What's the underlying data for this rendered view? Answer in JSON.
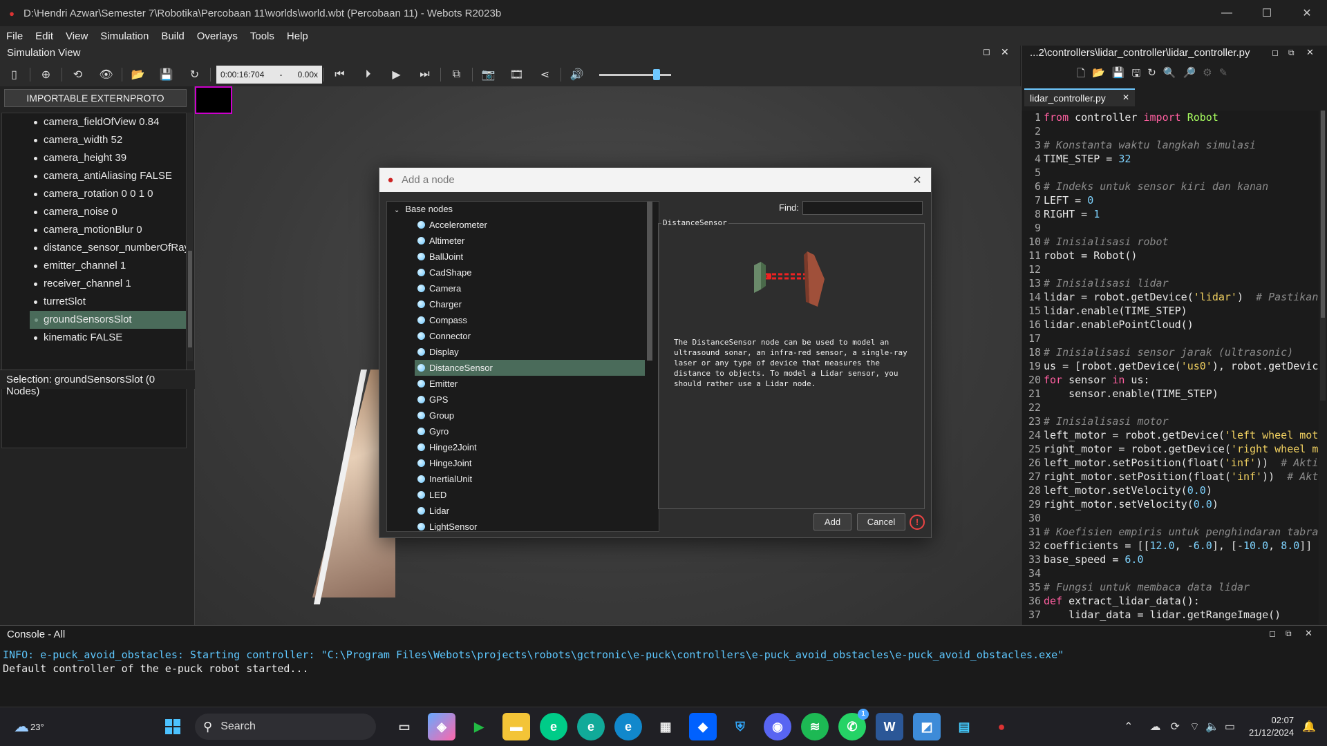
{
  "window": {
    "title": "D:\\Hendri Azwar\\Semester 7\\Robotika\\Percobaan 11\\worlds\\world.wbt (Percobaan 11) - Webots R2023b"
  },
  "menu": [
    "File",
    "Edit",
    "View",
    "Simulation",
    "Build",
    "Overlays",
    "Tools",
    "Help"
  ],
  "sim_view": {
    "title": "Simulation View",
    "time": "0:00:16:704",
    "sep": "-",
    "speed": "0.00x"
  },
  "scene": {
    "proto_button": "IMPORTABLE EXTERNPROTO",
    "fields": [
      "camera_fieldOfView 0.84",
      "camera_width 52",
      "camera_height 39",
      "camera_antiAliasing FALSE",
      "camera_rotation 0 0 1 0",
      "camera_noise 0",
      "camera_motionBlur 0",
      "distance_sensor_numberOfRays",
      "emitter_channel 1",
      "receiver_channel 1",
      "turretSlot",
      "groundSensorsSlot",
      "kinematic FALSE"
    ],
    "selection": "Selection: groundSensorsSlot (0 Nodes)"
  },
  "editor": {
    "path": "...2\\controllers\\lidar_controller\\lidar_controller.py",
    "tab": "lidar_controller.py",
    "lines": [
      "from controller import Robot",
      "",
      "# Konstanta waktu langkah simulasi",
      "TIME_STEP = 32",
      "",
      "# Indeks untuk sensor kiri dan kanan",
      "LEFT = 0",
      "RIGHT = 1",
      "",
      "# Inisialisasi robot",
      "robot = Robot()",
      "",
      "# Inisialisasi lidar",
      "lidar = robot.getDevice('lidar')  # Pastikan",
      "lidar.enable(TIME_STEP)",
      "lidar.enablePointCloud()",
      "",
      "# Inisialisasi sensor jarak (ultrasonic)",
      "us = [robot.getDevice('us0'), robot.getDevic",
      "for sensor in us:",
      "    sensor.enable(TIME_STEP)",
      "",
      "# Inisialisasi motor",
      "left_motor = robot.getDevice('left wheel mot",
      "right_motor = robot.getDevice('right wheel m",
      "left_motor.setPosition(float('inf'))  # Akti",
      "right_motor.setPosition(float('inf'))  # Akt",
      "left_motor.setVelocity(0.0)",
      "right_motor.setVelocity(0.0)",
      "",
      "# Koefisien empiris untuk penghindaran tabra",
      "coefficients = [[12.0, -6.0], [-10.0, 8.0]]",
      "base_speed = 6.0",
      "",
      "# Fungsi untuk membaca data lidar",
      "def extract_lidar_data():",
      "    lidar_data = lidar.getRangeImage()"
    ]
  },
  "dialog": {
    "title": "Add a node",
    "group": "Base nodes",
    "find_label": "Find:",
    "preview_title": "DistanceSensor",
    "description": "The DistanceSensor node can be used to model an ultrasound sonar, an infra-red sensor, a single-ray laser or any type of device that measures the distance to objects. To model a Lidar sensor, you should rather use a Lidar node.",
    "nodes": [
      "Accelerometer",
      "Altimeter",
      "BallJoint",
      "CadShape",
      "Camera",
      "Charger",
      "Compass",
      "Connector",
      "Display",
      "DistanceSensor",
      "Emitter",
      "GPS",
      "Group",
      "Gyro",
      "Hinge2Joint",
      "HingeJoint",
      "InertialUnit",
      "LED",
      "Lidar",
      "LightSensor"
    ],
    "add": "Add",
    "cancel": "Cancel"
  },
  "console": {
    "title": "Console - All",
    "lines": [
      "INFO: e-puck_avoid_obstacles: Starting controller: \"C:\\Program Files\\Webots\\projects\\robots\\gctronic\\e-puck\\controllers\\e-puck_avoid_obstacles\\e-puck_avoid_obstacles.exe\"",
      "Default controller of the e-puck robot started..."
    ]
  },
  "taskbar": {
    "weather": "23°",
    "search": "Search",
    "time": "02:07",
    "date": "21/12/2024",
    "badge": "1"
  },
  "colors": {
    "selection": "#4a6b5a",
    "accent_teal": "#6fc8ff",
    "info": "#5ec8ff"
  }
}
